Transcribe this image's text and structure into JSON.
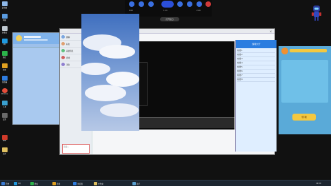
{
  "desktop": {
    "icons": [
      {
        "label": "此电脑",
        "color": "#8fb8e8"
      },
      {
        "label": "网络",
        "color": "#5a9be0"
      },
      {
        "label": "回收站",
        "color": "#c0c8d0"
      },
      {
        "label": "QQ",
        "color": "#1f9ae0"
      },
      {
        "label": "微信",
        "color": "#2bb34a"
      },
      {
        "label": "游戏",
        "color": "#e0a020"
      },
      {
        "label": "浏览器",
        "color": "#2f7de0"
      },
      {
        "label": "Chrome",
        "color": "#e44d3a"
      },
      {
        "label": "工具",
        "color": "#3aa0d0"
      },
      {
        "label": "设置",
        "color": "#6a6a6a"
      },
      {
        "label": "WPS",
        "color": "#d03a2a"
      },
      {
        "label": "文件",
        "color": "#e0c060"
      }
    ]
  },
  "topbar": {
    "left_value": "0.00",
    "mid_value": "1.11",
    "right_value": "2.00",
    "pill_label": "打开窗口"
  },
  "qq": {
    "title": "QQ",
    "contacts": [
      "群聊",
      "好友",
      "系统消息",
      "游戏",
      "消息"
    ],
    "input_placeholder": "请输入"
  },
  "right_panel": {
    "title": "游戏大厅",
    "rows": [
      "在线 1",
      "在线 2",
      "在线 3",
      "在线 4",
      "在线 5",
      "在线 6",
      "在线 7",
      "在线 8"
    ]
  },
  "promo": {
    "button": "领 取"
  },
  "taskbar": {
    "items": [
      {
        "label": "开始",
        "color": "#3a7bd5"
      },
      {
        "label": "QQ",
        "color": "#1f9ae0"
      },
      {
        "label": "微信",
        "color": "#2bb34a"
      },
      {
        "label": "游戏",
        "color": "#e0a020"
      },
      {
        "label": "浏览器",
        "color": "#2f7de0"
      },
      {
        "label": "文件夹",
        "color": "#e0c060"
      },
      {
        "label": "助手",
        "color": "#5aa0d0"
      }
    ],
    "clock": "12:00"
  },
  "colors": {
    "accent": "#2b4fd8",
    "panel": "#a9c9ef"
  }
}
